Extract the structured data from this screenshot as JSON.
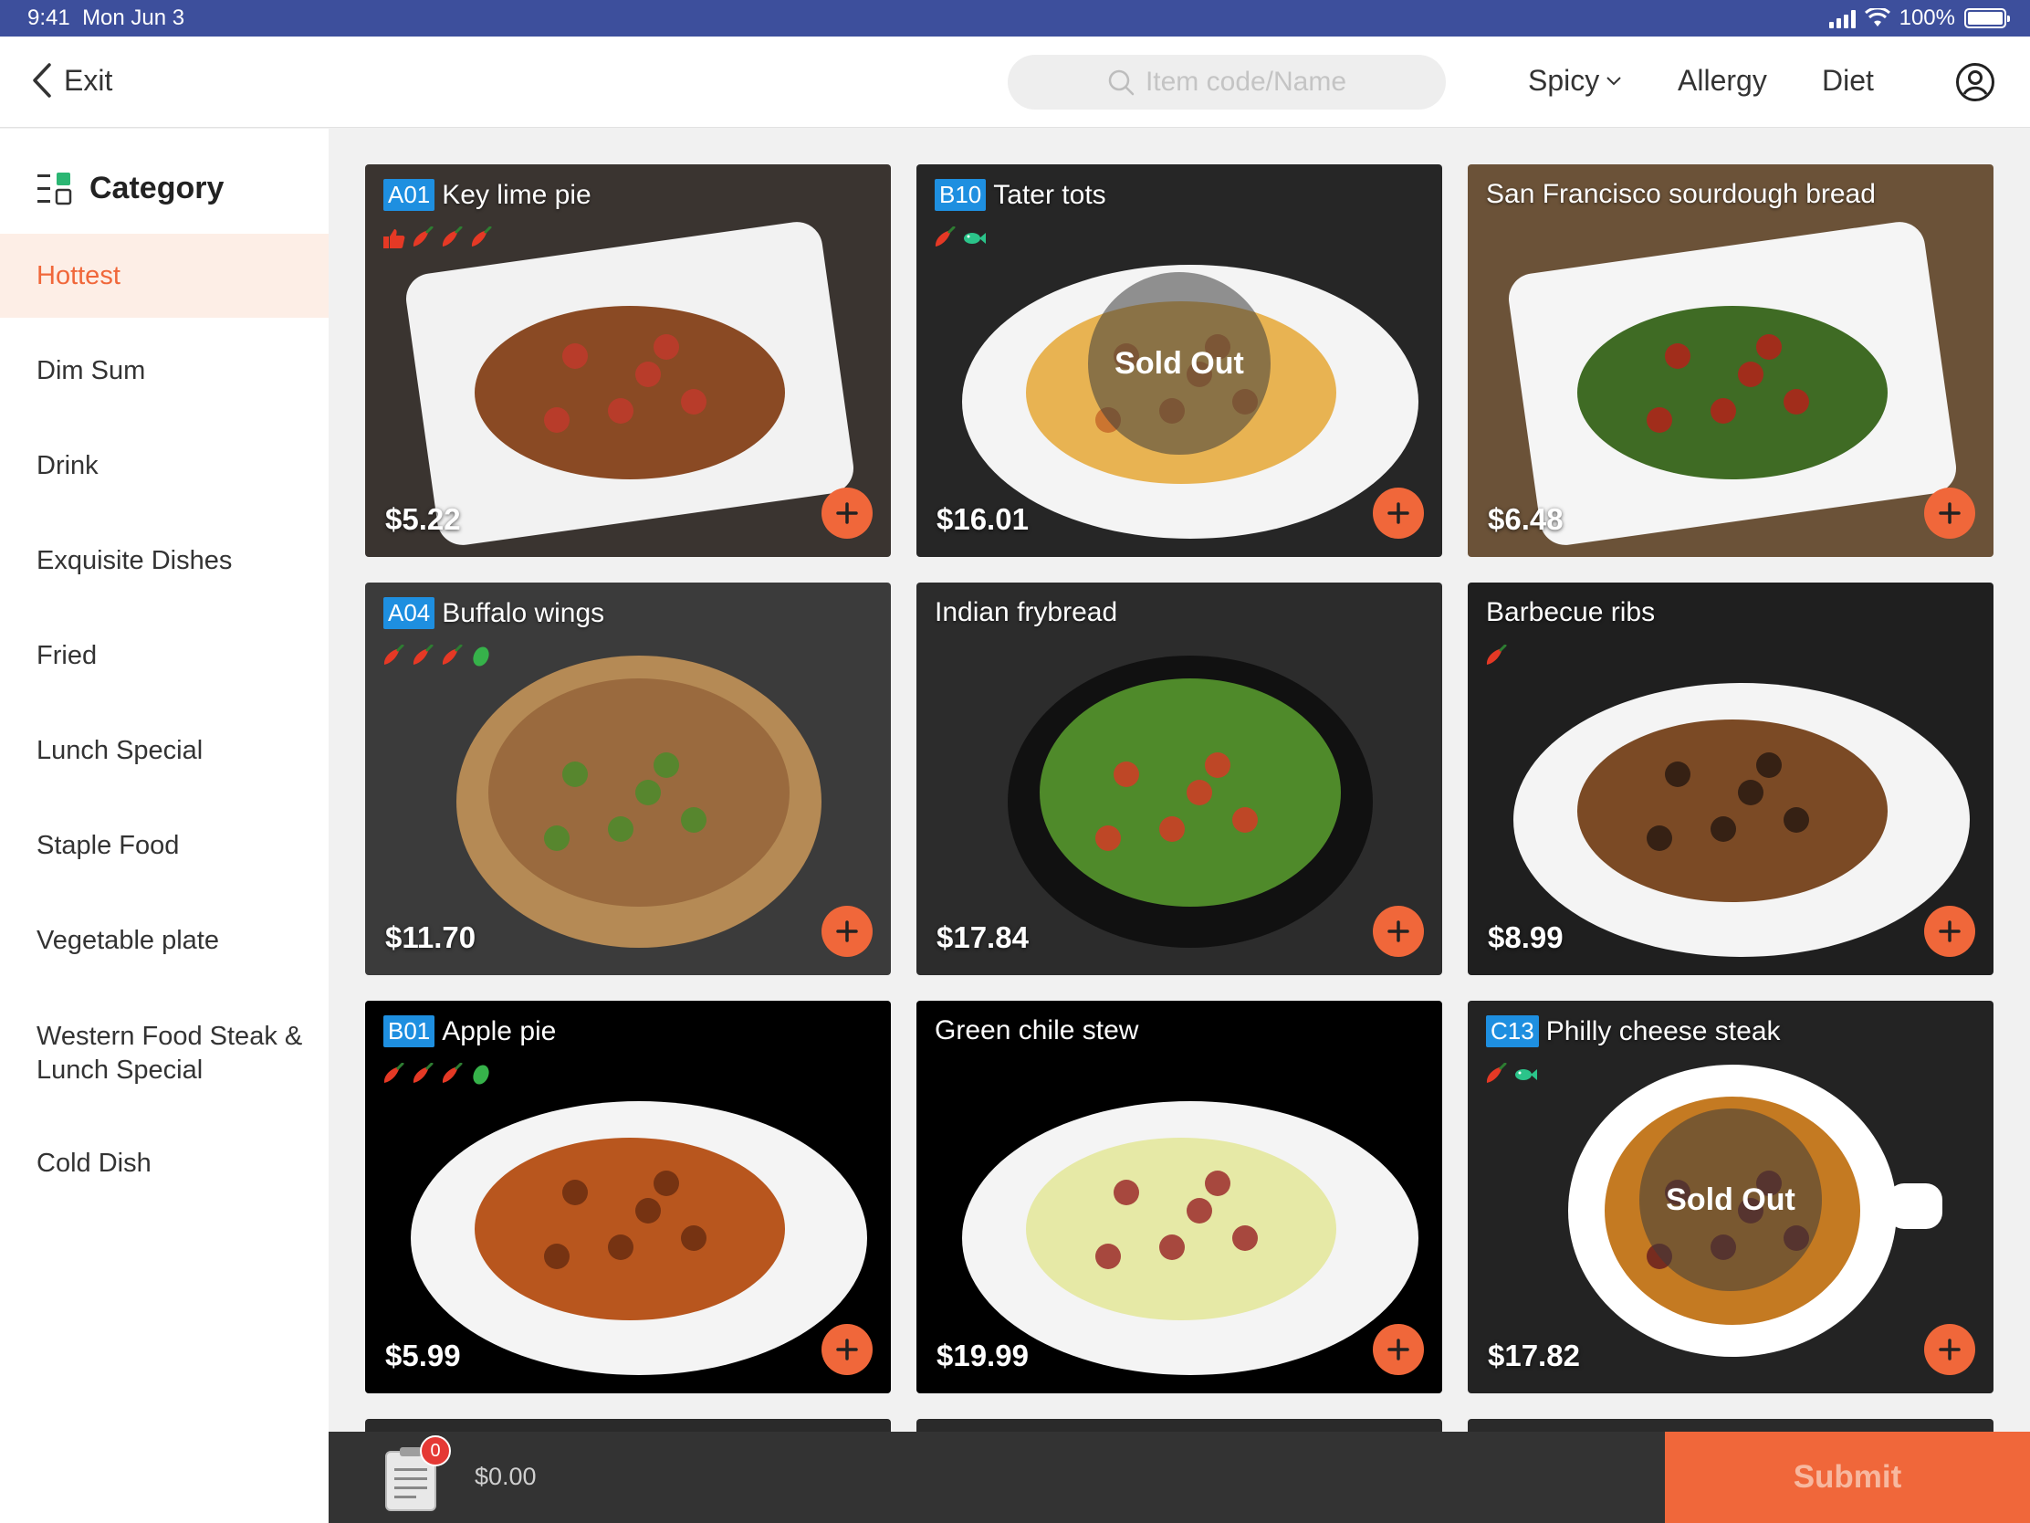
{
  "status": {
    "time": "9:41",
    "date": "Mon Jun 3",
    "battery": "100%"
  },
  "nav": {
    "exit_label": "Exit",
    "search_placeholder": "Item code/Name",
    "filters": [
      "Spicy",
      "Allergy",
      "Diet"
    ]
  },
  "sidebar": {
    "header": "Category",
    "items": [
      {
        "label": "Hottest",
        "active": true
      },
      {
        "label": "Dim Sum"
      },
      {
        "label": "Drink"
      },
      {
        "label": "Exquisite Dishes"
      },
      {
        "label": "Fried"
      },
      {
        "label": "Lunch Special"
      },
      {
        "label": "Staple Food"
      },
      {
        "label": "Vegetable plate"
      },
      {
        "label": "Western Food Steak & Lunch Special"
      },
      {
        "label": "Cold Dish"
      }
    ]
  },
  "items": [
    {
      "code": "A01",
      "name": "Key lime pie",
      "price": "$5.22",
      "tags": [
        "thumbs-up-icon",
        "chili-icon",
        "chili-icon",
        "chili-icon"
      ],
      "sold_out": false
    },
    {
      "code": "B10",
      "name": "Tater tots",
      "price": "$16.01",
      "tags": [
        "chili-icon",
        "fish-icon"
      ],
      "sold_out": true,
      "sold_label": "Sold Out"
    },
    {
      "code": "",
      "name": "San Francisco sourdough bread",
      "price": "$6.48",
      "tags": [],
      "sold_out": false
    },
    {
      "code": "A04",
      "name": "Buffalo wings",
      "price": "$11.70",
      "tags": [
        "chili-icon",
        "chili-icon",
        "chili-icon",
        "bean-icon"
      ],
      "sold_out": false
    },
    {
      "code": "",
      "name": "Indian frybread",
      "price": "$17.84",
      "tags": [],
      "sold_out": false
    },
    {
      "code": "",
      "name": "Barbecue ribs",
      "price": "$8.99",
      "tags": [
        "chili-icon"
      ],
      "sold_out": false
    },
    {
      "code": "B01",
      "name": "Apple pie",
      "price": "$5.99",
      "tags": [
        "chili-icon",
        "chili-icon",
        "chili-icon",
        "bean-icon"
      ],
      "sold_out": false
    },
    {
      "code": "",
      "name": "Green chile stew",
      "price": "$19.99",
      "tags": [],
      "sold_out": false
    },
    {
      "code": "C13",
      "name": "Philly cheese steak",
      "price": "$17.82",
      "tags": [
        "chili-icon",
        "fish-icon"
      ],
      "sold_out": true,
      "sold_label": "Sold Out"
    }
  ],
  "cart": {
    "count": "0",
    "total": "$0.00",
    "submit_label": "Submit"
  },
  "colors": {
    "accent": "#f0673a",
    "status_bar": "#3d4f9c",
    "code_badge": "#1e8fe0"
  }
}
